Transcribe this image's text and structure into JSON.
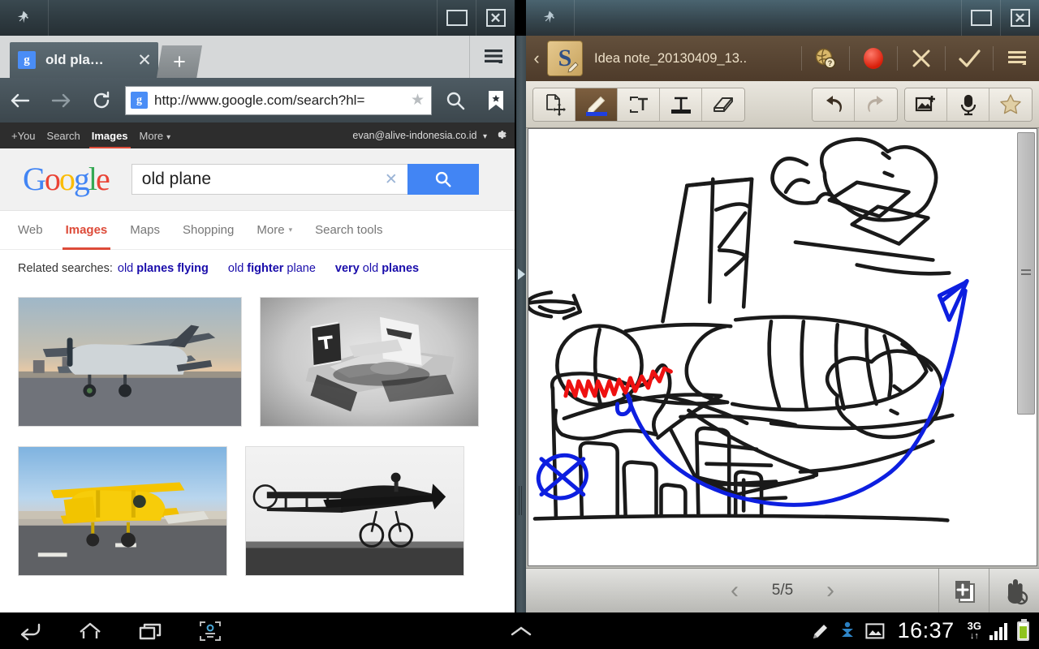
{
  "browser_window": {
    "titlebar": {
      "pin_icon": "pin-icon",
      "maximize_label": "maximize-icon",
      "close_label": "close-icon"
    },
    "tab": {
      "favicon": "google-favicon",
      "favicon_letter": "g",
      "label": "old pla…",
      "close_label": "✕"
    },
    "new_tab_label": "+",
    "menu_icon": "hamburger-menu-icon",
    "toolbar": {
      "back_icon": "back-arrow-icon",
      "forward_icon": "forward-arrow-icon",
      "reload_icon": "reload-icon",
      "url_favicon_letter": "g",
      "url": "http://www.google.com/search?hl=",
      "star_glyph": "★",
      "search_icon": "search-icon",
      "bookmarks_icon": "bookmark-icon"
    }
  },
  "google_bar": {
    "links": [
      "+You",
      "Search",
      "Images",
      "More"
    ],
    "current": "Images",
    "more_caret": "▾",
    "account": "evan@alive-indonesia.co.id",
    "account_caret": "▾",
    "gear_icon": "gear-icon"
  },
  "google_header": {
    "logo": [
      {
        "ch": "G",
        "cls": "b"
      },
      {
        "ch": "o",
        "cls": "r"
      },
      {
        "ch": "o",
        "cls": "y"
      },
      {
        "ch": "g",
        "cls": "b"
      },
      {
        "ch": "l",
        "cls": "g"
      },
      {
        "ch": "e",
        "cls": "r"
      }
    ],
    "query": "old plane",
    "clear_glyph": "✕",
    "search_button_icon": "search-icon"
  },
  "search_tabs": {
    "items": [
      {
        "label": "Web",
        "current": false,
        "caret": ""
      },
      {
        "label": "Images",
        "current": true,
        "caret": ""
      },
      {
        "label": "Maps",
        "current": false,
        "caret": ""
      },
      {
        "label": "Shopping",
        "current": false,
        "caret": ""
      },
      {
        "label": "More",
        "current": false,
        "caret": "▾"
      },
      {
        "label": "Search tools",
        "current": false,
        "caret": ""
      }
    ]
  },
  "related_searches": {
    "label": "Related searches:",
    "items": [
      {
        "pre": "old ",
        "bold": "planes flying",
        "post": ""
      },
      {
        "pre": "old ",
        "bold": "fighter",
        "post": " plane"
      },
      {
        "pre": "",
        "bold": "very",
        "post": " old ",
        "bold2": "planes"
      }
    ]
  },
  "image_results": [
    {
      "name": "biplane-at-dusk-thumbnail",
      "alt": "Grey biplane parked on runway at dusk"
    },
    {
      "name": "vintage-military-plane-thumbnail",
      "alt": "Black and white vintage military aircraft"
    },
    {
      "name": "yellow-biplane-thumbnail",
      "alt": "Yellow biplane on airfield tarmac"
    },
    {
      "name": "early-monoplane-thumbnail",
      "alt": "Black and white early monoplane in flight"
    }
  ],
  "divider": {
    "expand_icon": "expand-triangle-icon",
    "grip_icon": "drag-grip-icon"
  },
  "snote_window": {
    "titlebar": {
      "pin_icon": "pin-icon",
      "maximize_label": "maximize-icon",
      "close_label": "close-icon"
    },
    "back_glyph": "‹",
    "app_icon_letter": "S",
    "note_title": "Idea note_20130409_13..",
    "actions": [
      {
        "name": "share-globe-icon",
        "glyph": ""
      },
      {
        "name": "record-button",
        "glyph": ""
      },
      {
        "name": "cancel-icon",
        "glyph": "✕"
      },
      {
        "name": "confirm-check-icon",
        "glyph": "✓"
      },
      {
        "name": "snote-menu-icon",
        "glyph": ""
      }
    ],
    "tools_left": [
      {
        "name": "move-select-tool",
        "active": false
      },
      {
        "name": "pen-tool",
        "active": true
      },
      {
        "name": "text-box-tool",
        "active": false
      },
      {
        "name": "text-tool",
        "active": false
      },
      {
        "name": "eraser-tool",
        "active": false
      }
    ],
    "tools_right": [
      {
        "name": "undo-button",
        "enabled": true
      },
      {
        "name": "redo-button",
        "enabled": false
      }
    ],
    "tools_last": [
      {
        "name": "insert-image-button"
      },
      {
        "name": "voice-record-button"
      },
      {
        "name": "favorite-star-button"
      }
    ],
    "canvas": {
      "name": "note-drawing-canvas",
      "description": "Hand-drawn sketch of an airplane over a city skyline with clouds, a flag with red scribble, a crossed-out circle and a blue rising arrow",
      "ink_colors": {
        "black": "#1a1a1a",
        "blue": "#0d1fe0",
        "red": "#ee1111"
      }
    },
    "page_nav": {
      "prev_glyph": "‹",
      "indicator": "5/5",
      "next_glyph": "›",
      "add_page_icon": "add-page-icon",
      "hand_disabled_icon": "hand-blocked-icon"
    }
  },
  "system_nav": {
    "buttons": [
      {
        "name": "back-nav-button"
      },
      {
        "name": "home-nav-button"
      },
      {
        "name": "recent-apps-nav-button"
      },
      {
        "name": "screen-capture-nav-button"
      }
    ],
    "expand_glyph": "⌃",
    "status": {
      "pen_icon": "stylus-icon",
      "sync_icon": "sync-icon",
      "image_icon": "screenshot-icon",
      "time": "16:37",
      "network_type": "3G",
      "network_arrows": "↓↑",
      "signal_icon": "signal-bars-icon",
      "battery_icon": "battery-icon"
    }
  }
}
